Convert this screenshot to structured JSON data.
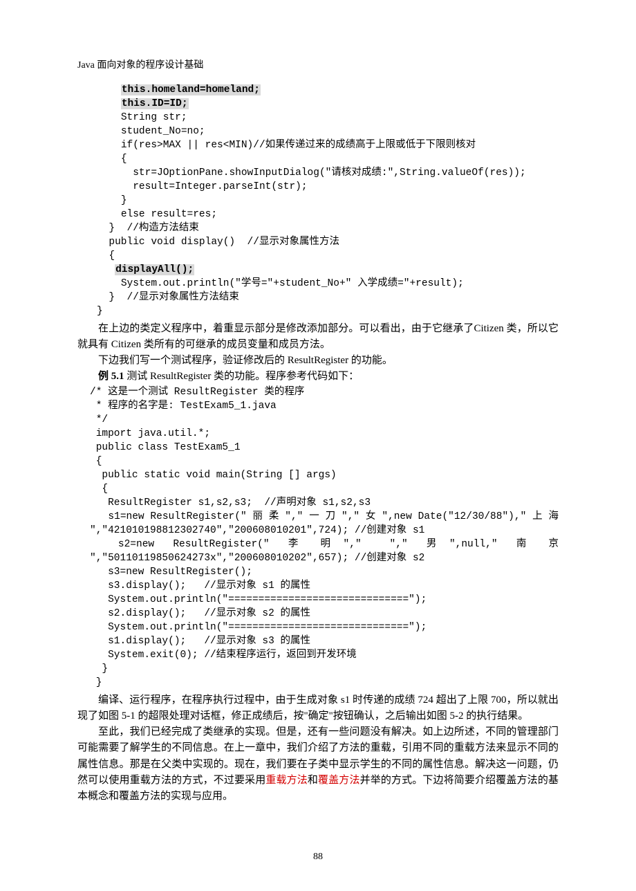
{
  "header": "Java 面向对象的程序设计基础",
  "code1": {
    "l1a": "    ",
    "l1b": "this.homeland=homeland;",
    "l2a": "    ",
    "l2b": "this.ID=ID;",
    "l3": "    String str;",
    "l4": "    student_No=no;",
    "l5": "    if(res>MAX || res<MIN)//如果传递过来的成绩高于上限或低于下限则核对",
    "l6": "    {",
    "l7": "      str=JOptionPane.showInputDialog(\"请核对成绩:\",String.valueOf(res));",
    "l8": "      result=Integer.parseInt(str);",
    "l9": "    }",
    "l10": "    else result=res;",
    "l11": "  }  //构造方法结束",
    "l12": "  public void display()  //显示对象属性方法",
    "l13": "  {",
    "l14a": "   ",
    "l14b": "displayAll();",
    "l15": "    System.out.println(\"学号=\"+student_No+\" 入学成绩=\"+result);",
    "l16": "  }  //显示对象属性方法结束",
    "l17": "}"
  },
  "para1": "在上边的类定义程序中，着重显示部分是修改添加部分。可以看出，由于它继承了Citizen 类，所以它就具有 Citizen 类所有的可继承的成员变量和成员方法。",
  "para2": "下边我们写一个测试程序，验证修改后的 ResultRegister 的功能。",
  "example": {
    "label": "例 5.1",
    "text": "   测试 ResultRegister 类的功能。程序参考代码如下："
  },
  "code2": {
    "c1": "/* 这是一个测试 ResultRegister 类的程序",
    "c2": " * 程序的名字是: TestExam5_1.java",
    "c3": " */",
    "c4": " import java.util.*;",
    "c5": " public class TestExam5_1",
    "c6": " {",
    "c7": "  public static void main(String [] args)",
    "c8": "  {",
    "c9": "   ResultRegister s1,s2,s3;  //声明对象 s1,s2,s3",
    "c10pre": "   ",
    "c10a": "s1=new ResultRegister(\" 丽 柔 \",\" 一 刀 \",\" 女 \",new Date(\"12/30/88\"),\" 上 海",
    "c10b": "\",\"421010198812302740\",\"200608010201\",724); //创建对象 s1",
    "c11pre": "   ",
    "c11a": "s2=new  ResultRegister(\"  李  明 \",\"   \",\"  男 \",null,\"  南  京",
    "c11b": "\",\"50110119850624273x\",\"200608010202\",657); //创建对象 s2",
    "c12": "   s3=new ResultRegister();",
    "c13": "   s3.display();   //显示对象 s1 的属性",
    "c14": "   System.out.println(\"==============================\");",
    "c15": "   s2.display();   //显示对象 s2 的属性",
    "c16": "   System.out.println(\"==============================\");",
    "c17": "   s1.display();   //显示对象 s3 的属性",
    "c18": "   System.exit(0); //结束程序运行，返回到开发环境",
    "c19": "  }",
    "c20": " }"
  },
  "para3": "编译、运行程序，在程序执行过程中，由于生成对象 s1 时传递的成绩 724 超出了上限 700，所以就出现了如图 5-1 的超限处理对话框，修正成绩后，按\"确定\"按钮确认，之后输出如图 5-2 的执行结果。",
  "para4a": "至此，我们已经完成了类继承的实现。但是，还有一些问题没有解决。如上边所述，不同的管理部门可能需要了解学生的不同信息。在上一章中，我们介绍了方法的重载，引用不同的重载方法来显示不同的属性信息。那是在父类中实现的。现在，我们要在子类中显示学生的不同的属性信息。解决这一问题，仍然可以使用重载方法的方式，不过要采用",
  "para4_r1": "重载方法",
  "para4b": "和",
  "para4_r2": "覆盖方法",
  "para4c": "并举的方式。下边将简要介绍覆盖方法的基本概念和覆盖方法的实现与应用。",
  "pageno": "88"
}
